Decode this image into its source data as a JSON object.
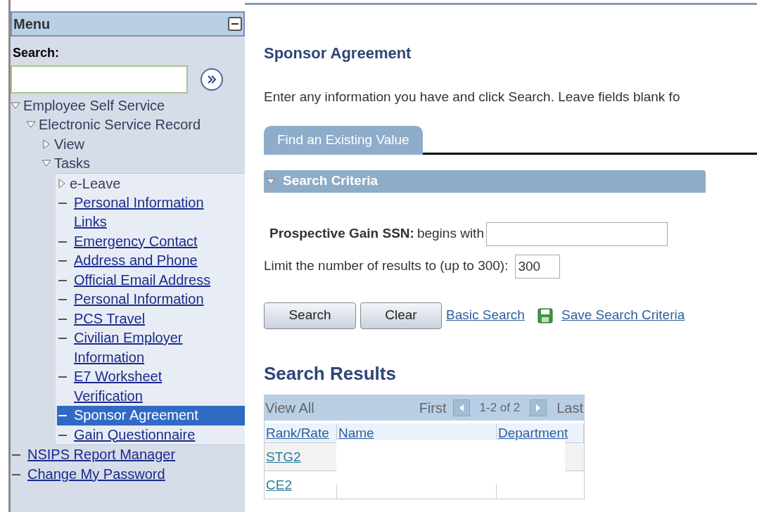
{
  "menu": {
    "title": "Menu",
    "collapsed": false,
    "search_label": "Search:",
    "tree": [
      {
        "label": "Employee Self Service",
        "kind": "folder",
        "expanded": true,
        "children": [
          {
            "label": "Electronic Service Record",
            "kind": "folder",
            "expanded": true,
            "children": [
              {
                "label": "View",
                "kind": "folder",
                "expanded": false
              },
              {
                "label": "Tasks",
                "kind": "folder",
                "expanded": true,
                "children": [
                  {
                    "label": "e-Leave",
                    "kind": "folder",
                    "expanded": false
                  },
                  {
                    "label": "Personal Information Links",
                    "kind": "link",
                    "selected": false
                  },
                  {
                    "label": "Emergency Contact",
                    "kind": "link",
                    "selected": false
                  },
                  {
                    "label": "Address and Phone",
                    "kind": "link",
                    "selected": false
                  },
                  {
                    "label": "Official Email Address",
                    "kind": "link",
                    "selected": false
                  },
                  {
                    "label": "Personal Information",
                    "kind": "link",
                    "selected": false
                  },
                  {
                    "label": "PCS Travel",
                    "kind": "link",
                    "selected": false
                  },
                  {
                    "label": "Civilian Employer Information",
                    "kind": "link",
                    "selected": false
                  },
                  {
                    "label": "E7 Worksheet Verification",
                    "kind": "link",
                    "selected": false
                  },
                  {
                    "label": "Sponsor Agreement",
                    "kind": "link",
                    "selected": true
                  },
                  {
                    "label": "Gain Questionnaire",
                    "kind": "link",
                    "selected": false
                  }
                ]
              }
            ]
          }
        ]
      },
      {
        "label": "NSIPS Report Manager",
        "kind": "link",
        "selected": false
      },
      {
        "label": "Change My Password",
        "kind": "link",
        "selected": false
      }
    ]
  },
  "page_title": "Sponsor Agreement",
  "instructions": "Enter any information you have and click Search. Leave fields blank fo",
  "tabs": [
    {
      "label": "Find an Existing Value",
      "selected": true
    }
  ],
  "search_criteria": {
    "title": "Search Criteria",
    "expanded": true,
    "ssn_label": "Prospective Gain SSN:",
    "ssn_operator": "begins with",
    "limit_label": "Limit the number of results to (up to 300):",
    "limit_value": "300"
  },
  "buttons": [
    "Search",
    "Clear"
  ],
  "links": [
    "Basic Search",
    "Save Search Criteria"
  ],
  "results": {
    "title": "Search Results",
    "view_all": "View All",
    "first": "First",
    "range": "1-2 of 2",
    "last": "Last",
    "columns": [
      "Rank/Rate",
      "Name",
      "Department"
    ],
    "rows": [
      {
        "rank_rate": "STG2"
      },
      {
        "rank_rate": "CE2"
      }
    ]
  }
}
